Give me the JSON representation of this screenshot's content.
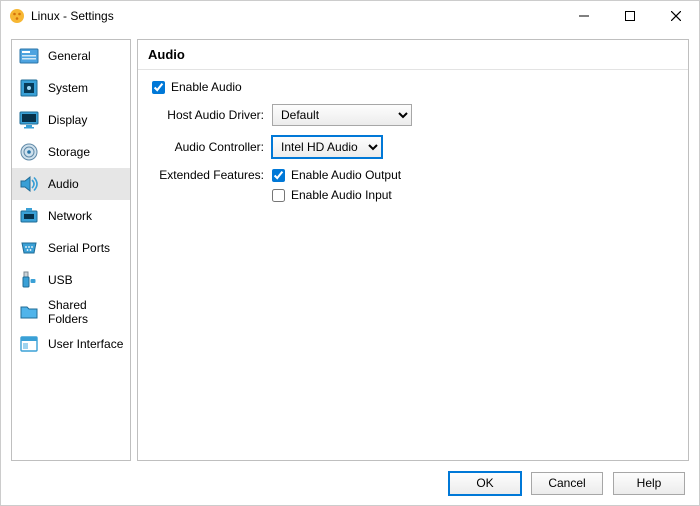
{
  "window": {
    "title": "Linux - Settings"
  },
  "sidebar": {
    "items": [
      {
        "id": "general",
        "label": "General",
        "selected": false
      },
      {
        "id": "system",
        "label": "System",
        "selected": false
      },
      {
        "id": "display",
        "label": "Display",
        "selected": false
      },
      {
        "id": "storage",
        "label": "Storage",
        "selected": false
      },
      {
        "id": "audio",
        "label": "Audio",
        "selected": true
      },
      {
        "id": "network",
        "label": "Network",
        "selected": false
      },
      {
        "id": "serial-ports",
        "label": "Serial Ports",
        "selected": false
      },
      {
        "id": "usb",
        "label": "USB",
        "selected": false
      },
      {
        "id": "shared-folders",
        "label": "Shared Folders",
        "selected": false
      },
      {
        "id": "user-interface",
        "label": "User Interface",
        "selected": false
      }
    ]
  },
  "page": {
    "title": "Audio",
    "enable_audio": {
      "label": "Enable Audio",
      "checked": true
    },
    "host_driver": {
      "label": "Host Audio Driver:",
      "value": "Default"
    },
    "controller": {
      "label": "Audio Controller:",
      "value": "Intel HD Audio"
    },
    "extended_label": "Extended Features:",
    "enable_output": {
      "label": "Enable Audio Output",
      "checked": true
    },
    "enable_input": {
      "label": "Enable Audio Input",
      "checked": false
    }
  },
  "buttons": {
    "ok": "OK",
    "cancel": "Cancel",
    "help": "Help"
  }
}
